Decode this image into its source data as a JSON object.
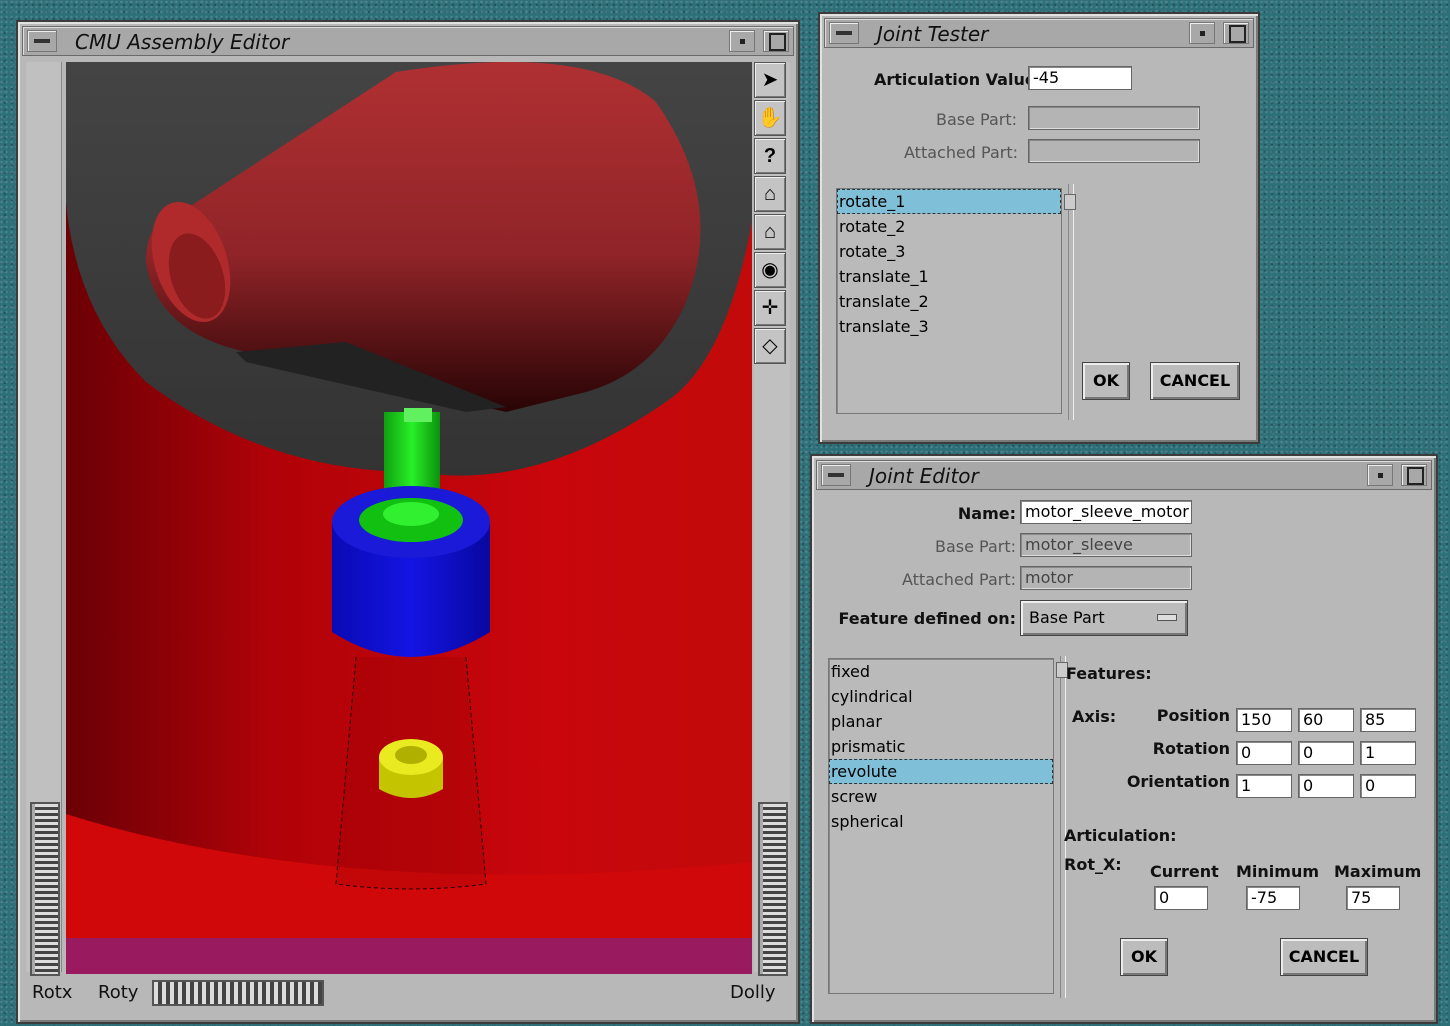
{
  "assembly_editor": {
    "title": "CMU Assembly Editor",
    "rotx_label": "Rotx",
    "roty_label": "Roty",
    "dolly_label": "Dolly",
    "tools": [
      {
        "icon": "pointer-arrow-icon",
        "glyph": "➤"
      },
      {
        "icon": "hand-icon",
        "glyph": "✋"
      },
      {
        "icon": "help-question-icon",
        "glyph": "?"
      },
      {
        "icon": "home-icon",
        "glyph": "⌂"
      },
      {
        "icon": "set-home-icon",
        "glyph": "⌂"
      },
      {
        "icon": "view-all-eye-icon",
        "glyph": "◉"
      },
      {
        "icon": "seek-crosshair-icon",
        "glyph": "✛"
      },
      {
        "icon": "projection-cube-icon",
        "glyph": "◇"
      }
    ]
  },
  "joint_tester": {
    "title": "Joint Tester",
    "articulation_label": "Articulation Value:",
    "articulation_value": "-45",
    "base_part_label": "Base Part:",
    "base_part_value": "",
    "attached_part_label": "Attached Part:",
    "attached_part_value": "",
    "items": [
      "rotate_1",
      "rotate_2",
      "rotate_3",
      "translate_1",
      "translate_2",
      "translate_3"
    ],
    "selected_index": 0,
    "ok_label": "OK",
    "cancel_label": "CANCEL"
  },
  "joint_editor": {
    "title": "Joint Editor",
    "name_label": "Name:",
    "name_value": "motor_sleeve_motor",
    "base_part_label": "Base Part:",
    "base_part_value": "motor_sleeve",
    "attached_part_label": "Attached Part:",
    "attached_part_value": "motor",
    "feature_label": "Feature defined on:",
    "feature_value": "Base Part",
    "joint_types": [
      "fixed",
      "cylindrical",
      "planar",
      "prismatic",
      "revolute",
      "screw",
      "spherical"
    ],
    "selected_index": 4,
    "features_label": "Features:",
    "axis_label": "Axis:",
    "position_label": "Position",
    "position": [
      "150",
      "60",
      "85"
    ],
    "rotation_label": "Rotation",
    "rotation": [
      "0",
      "0",
      "1"
    ],
    "orientation_label": "Orientation",
    "orientation": [
      "1",
      "0",
      "0"
    ],
    "articulation_label": "Articulation:",
    "rot_label": "Rot_X:",
    "current_label": "Current",
    "minimum_label": "Minimum",
    "maximum_label": "Maximum",
    "current_value": "0",
    "minimum_value": "-75",
    "maximum_value": "75",
    "ok_label": "OK",
    "cancel_label": "CANCEL"
  },
  "colors": {
    "desktop": "#2e7078",
    "window": "#b8b8b8",
    "selection": "#7fc0d8",
    "scene_red": "#c0080a",
    "scene_blue": "#1010d8",
    "scene_green": "#10d010",
    "scene_yellow": "#e0e000"
  }
}
